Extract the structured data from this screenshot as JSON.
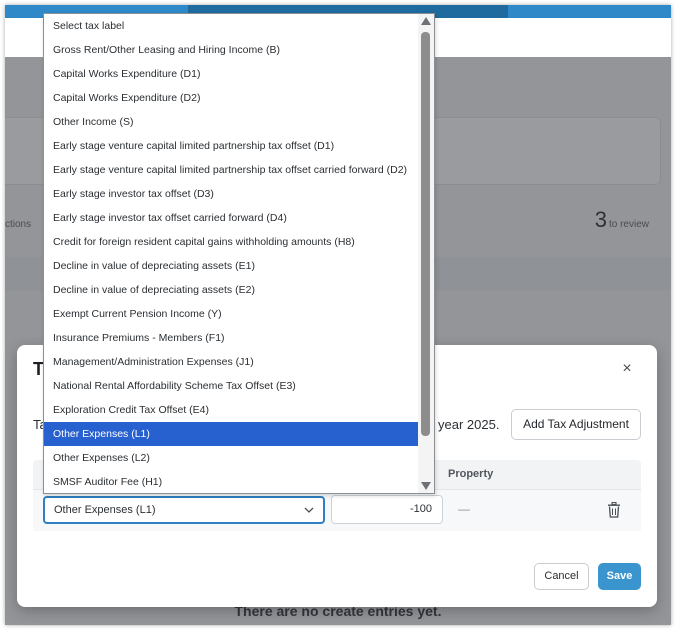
{
  "background": {
    "actions_label": "ctions",
    "review_count": "3",
    "review_label": "to review",
    "empty_message": "There are no create entries yet."
  },
  "modal": {
    "title": "T",
    "description_left": "Ta",
    "description_right": "year 2025.",
    "add_button": "Add Tax Adjustment",
    "close_symbol": "×",
    "table": {
      "property_header": "Property",
      "row": {
        "selected_label": "Other Expenses (L1)",
        "amount": "-100",
        "property": "—"
      }
    },
    "cancel_button": "Cancel",
    "save_button": "Save"
  },
  "dropdown": {
    "selected_index": 16,
    "options": [
      "Select tax label",
      "Gross Rent/Other Leasing and Hiring Income (B)",
      "Capital Works Expenditure (D1)",
      "Capital Works Expenditure (D2)",
      "Other Income (S)",
      "Early stage venture capital limited partnership tax offset (D1)",
      "Early stage venture capital limited partnership tax offset carried forward (D2)",
      "Early stage investor tax offset (D3)",
      "Early stage investor tax offset carried forward (D4)",
      "Credit for foreign resident capital gains withholding amounts (H8)",
      "Decline in value of depreciating assets (E1)",
      "Decline in value of depreciating assets (E2)",
      "Exempt Current Pension Income (Y)",
      "Insurance Premiums - Members (F1)",
      "Management/Administration Expenses (J1)",
      "National Rental Affordability Scheme Tax Offset (E3)",
      "Exploration Credit Tax Offset (E4)",
      "Other Expenses (L1)",
      "Other Expenses (L2)",
      "SMSF Auditor Fee (H1)"
    ]
  },
  "colors": {
    "accent": "#2f89c9",
    "selected_option": "#2760cf",
    "save_button": "#3a95cf",
    "focus_border": "#2f7fc2"
  }
}
